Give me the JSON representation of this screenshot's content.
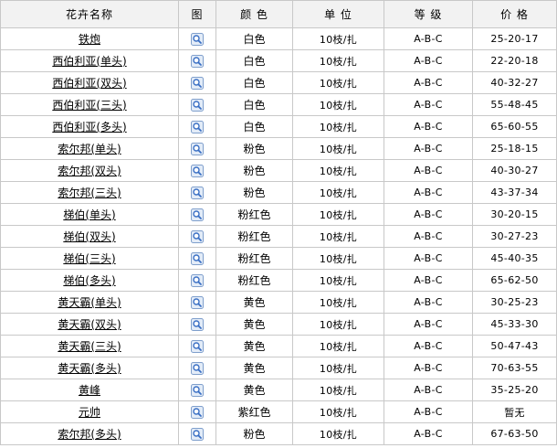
{
  "columns": [
    "花卉名称",
    "图",
    "颜 色",
    "单 位",
    "等 级",
    "价 格"
  ],
  "rows": [
    {
      "name": "铁炮",
      "color": "白色",
      "unit": "10枝/扎",
      "grade": "A-B-C",
      "price": "25-20-17"
    },
    {
      "name": "西伯利亚(单头)",
      "color": "白色",
      "unit": "10枝/扎",
      "grade": "A-B-C",
      "price": "22-20-18"
    },
    {
      "name": "西伯利亚(双头)",
      "color": "白色",
      "unit": "10枝/扎",
      "grade": "A-B-C",
      "price": "40-32-27"
    },
    {
      "name": "西伯利亚(三头)",
      "color": "白色",
      "unit": "10枝/扎",
      "grade": "A-B-C",
      "price": "55-48-45"
    },
    {
      "name": "西伯利亚(多头)",
      "color": "白色",
      "unit": "10枝/扎",
      "grade": "A-B-C",
      "price": "65-60-55"
    },
    {
      "name": "索尔邦(单头)",
      "color": "粉色",
      "unit": "10枝/扎",
      "grade": "A-B-C",
      "price": "25-18-15"
    },
    {
      "name": "索尔邦(双头)",
      "color": "粉色",
      "unit": "10枝/扎",
      "grade": "A-B-C",
      "price": "40-30-27"
    },
    {
      "name": "索尔邦(三头)",
      "color": "粉色",
      "unit": "10枝/扎",
      "grade": "A-B-C",
      "price": "43-37-34"
    },
    {
      "name": "梯伯(单头)",
      "color": "粉红色",
      "unit": "10枝/扎",
      "grade": "A-B-C",
      "price": "30-20-15"
    },
    {
      "name": "梯伯(双头)",
      "color": "粉红色",
      "unit": "10枝/扎",
      "grade": "A-B-C",
      "price": "30-27-23"
    },
    {
      "name": "梯伯(三头)",
      "color": "粉红色",
      "unit": "10枝/扎",
      "grade": "A-B-C",
      "price": "45-40-35"
    },
    {
      "name": "梯伯(多头)",
      "color": "粉红色",
      "unit": "10枝/扎",
      "grade": "A-B-C",
      "price": "65-62-50"
    },
    {
      "name": "黄天霸(单头)",
      "color": "黄色",
      "unit": "10枝/扎",
      "grade": "A-B-C",
      "price": "30-25-23"
    },
    {
      "name": "黄天霸(双头)",
      "color": "黄色",
      "unit": "10枝/扎",
      "grade": "A-B-C",
      "price": "45-33-30"
    },
    {
      "name": "黄天霸(三头)",
      "color": "黄色",
      "unit": "10枝/扎",
      "grade": "A-B-C",
      "price": "50-47-43"
    },
    {
      "name": "黄天霸(多头)",
      "color": "黄色",
      "unit": "10枝/扎",
      "grade": "A-B-C",
      "price": "70-63-55"
    },
    {
      "name": "黄峰",
      "color": "黄色",
      "unit": "10枝/扎",
      "grade": "A-B-C",
      "price": "35-25-20"
    },
    {
      "name": "元帅",
      "color": "紫红色",
      "unit": "10枝/扎",
      "grade": "A-B-C",
      "price": "暂无"
    },
    {
      "name": "索尔邦(多头)",
      "color": "粉色",
      "unit": "10枝/扎",
      "grade": "A-B-C",
      "price": "67-63-50"
    }
  ],
  "image_icon": "magnifier-icon",
  "colors": {
    "header_bg": "#f2f2f2",
    "border": "#c8c8c8",
    "icon_blue": "#3a6fc4"
  }
}
